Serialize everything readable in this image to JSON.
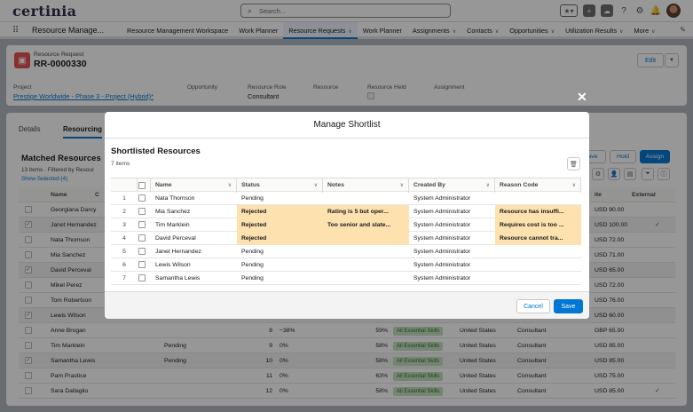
{
  "header": {
    "logo": "certinia",
    "search_placeholder": "Search..."
  },
  "nav": {
    "app_name": "Resource Manage...",
    "items": [
      {
        "label": "Resource Management Workspace",
        "chevron": false,
        "active": false
      },
      {
        "label": "Work Planner",
        "chevron": false,
        "active": false
      },
      {
        "label": "Resource Requests",
        "chevron": true,
        "active": true
      },
      {
        "label": "Work Planner",
        "chevron": false,
        "active": false
      },
      {
        "label": "Assignments",
        "chevron": true,
        "active": false
      },
      {
        "label": "Contacts",
        "chevron": true,
        "active": false
      },
      {
        "label": "Opportunities",
        "chevron": true,
        "active": false
      },
      {
        "label": "Utilization Results",
        "chevron": true,
        "active": false
      },
      {
        "label": "More",
        "chevron": true,
        "active": false
      }
    ]
  },
  "record": {
    "object_label": "Resource Request",
    "name": "RR-0000330",
    "edit_label": "Edit",
    "fields": {
      "project_label": "Project",
      "project_value": "Prestige Worldwide - Phase 3 - Project (Hybrid)*",
      "opportunity_label": "Opportunity",
      "role_label": "Resource Role",
      "role_value": "Consultant",
      "resource_label": "Resource",
      "held_label": "Resource Held",
      "assignment_label": "Assignment"
    }
  },
  "background": {
    "tabs": [
      "Details",
      "Resourcing"
    ],
    "matched_title": "Matched Resources",
    "matched_sub": "13 items · Filtered by Resour",
    "show_selected": "Show Selected (4)",
    "buttons": {
      "save": "ave",
      "hold": "Hold",
      "assign": "Assign"
    },
    "columns": {
      "name": "Name",
      "rate": "ite",
      "external": "External",
      "extra": "C"
    },
    "rows": [
      {
        "name": "Georgiana Darcy",
        "checked": false,
        "status": "",
        "num": "",
        "pct": "",
        "score": "",
        "skills": "",
        "country": "",
        "role": "",
        "rate": "USD 90.00",
        "external": false
      },
      {
        "name": "Janet Hernandez",
        "checked": true,
        "status": "",
        "num": "",
        "pct": "",
        "score": "",
        "skills": "",
        "country": "",
        "role": "",
        "rate": "USD 100.00",
        "external": true
      },
      {
        "name": "Nata Thomson",
        "checked": false,
        "status": "",
        "num": "",
        "pct": "",
        "score": "",
        "skills": "",
        "country": "",
        "role": "",
        "rate": "USD 72.00",
        "external": false
      },
      {
        "name": "Mia Sanchez",
        "checked": false,
        "status": "",
        "num": "",
        "pct": "",
        "score": "",
        "skills": "",
        "country": "",
        "role": "",
        "rate": "USD 71.00",
        "external": false
      },
      {
        "name": "David Perceval",
        "checked": true,
        "status": "",
        "num": "",
        "pct": "",
        "score": "",
        "skills": "",
        "country": "",
        "role": "",
        "rate": "USD 65.00",
        "external": false
      },
      {
        "name": "Mikel Perez",
        "checked": false,
        "status": "",
        "num": "",
        "pct": "",
        "score": "",
        "skills": "",
        "country": "",
        "role": "",
        "rate": "USD 72.00",
        "external": false
      },
      {
        "name": "Tom Robertson",
        "checked": false,
        "status": "",
        "num": "",
        "pct": "",
        "score": "",
        "skills": "",
        "country": "",
        "role": "",
        "rate": "USD 76.00",
        "external": false
      },
      {
        "name": "Lewis Wilson",
        "checked": true,
        "status": "",
        "num": "",
        "pct": "",
        "score": "",
        "skills": "",
        "country": "",
        "role": "",
        "rate": "USD 60.00",
        "external": false
      },
      {
        "name": "Anne Brogan",
        "checked": false,
        "status": "",
        "num": "8",
        "pct": "−38%",
        "score": "59%",
        "skills": "All Essential Skills",
        "country": "United States",
        "role": "Consultant",
        "rate": "GBP 65.00",
        "external": false
      },
      {
        "name": "Tim Marklein",
        "checked": false,
        "status": "Pending",
        "num": "9",
        "pct": "0%",
        "score": "58%",
        "skills": "All Essential Skills",
        "country": "United States",
        "role": "Consultant",
        "rate": "USD 85.00",
        "external": false
      },
      {
        "name": "Samantha Lewis",
        "checked": true,
        "status": "Pending",
        "num": "10",
        "pct": "0%",
        "score": "58%",
        "skills": "All Essential Skills",
        "country": "United States",
        "role": "Consultant",
        "rate": "USD 85.00",
        "external": false
      },
      {
        "name": "Pam Practice",
        "checked": false,
        "status": "",
        "num": "11",
        "pct": "0%",
        "score": "63%",
        "skills": "All Essential Skills",
        "country": "United States",
        "role": "Consultant",
        "rate": "USD 75.00",
        "external": false
      },
      {
        "name": "Sara Dallaglio",
        "checked": false,
        "status": "",
        "num": "12",
        "pct": "0%",
        "score": "58%",
        "skills": "All Essential Skills",
        "country": "United States",
        "role": "Consultant",
        "rate": "USD 85.00",
        "external": true
      }
    ]
  },
  "modal": {
    "title": "Manage Shortlist",
    "section_title": "Shortlisted Resources",
    "count": "7 items",
    "columns": {
      "name": "Name",
      "status": "Status",
      "notes": "Notes",
      "created_by": "Created By",
      "reason": "Reason Code"
    },
    "rows": [
      {
        "num": "1",
        "name": "Nata Thomson",
        "status": "Pending",
        "notes": "",
        "created_by": "System Administrator",
        "reason": ""
      },
      {
        "num": "2",
        "name": "Mia Sanchez",
        "status": "Rejected",
        "notes": "Rating is 5 but oper...",
        "created_by": "System Administrator",
        "reason": "Resource has insuffi..."
      },
      {
        "num": "3",
        "name": "Tim Marklein",
        "status": "Rejected",
        "notes": "Too senior and slate...",
        "created_by": "System Administrator",
        "reason": "Requires cost is too ..."
      },
      {
        "num": "4",
        "name": "David Perceval",
        "status": "Rejected",
        "notes": "",
        "created_by": "System Administrator",
        "reason": "Resource cannot tra..."
      },
      {
        "num": "5",
        "name": "Janet Hernandez",
        "status": "Pending",
        "notes": "",
        "created_by": "System Administrator",
        "reason": ""
      },
      {
        "num": "6",
        "name": "Lewis Wilson",
        "status": "Pending",
        "notes": "",
        "created_by": "System Administrator",
        "reason": ""
      },
      {
        "num": "7",
        "name": "Samantha Lewis",
        "status": "Pending",
        "notes": "",
        "created_by": "System Administrator",
        "reason": ""
      }
    ],
    "cancel_label": "Cancel",
    "save_label": "Save",
    "highlight_color": "#fde2b0"
  }
}
